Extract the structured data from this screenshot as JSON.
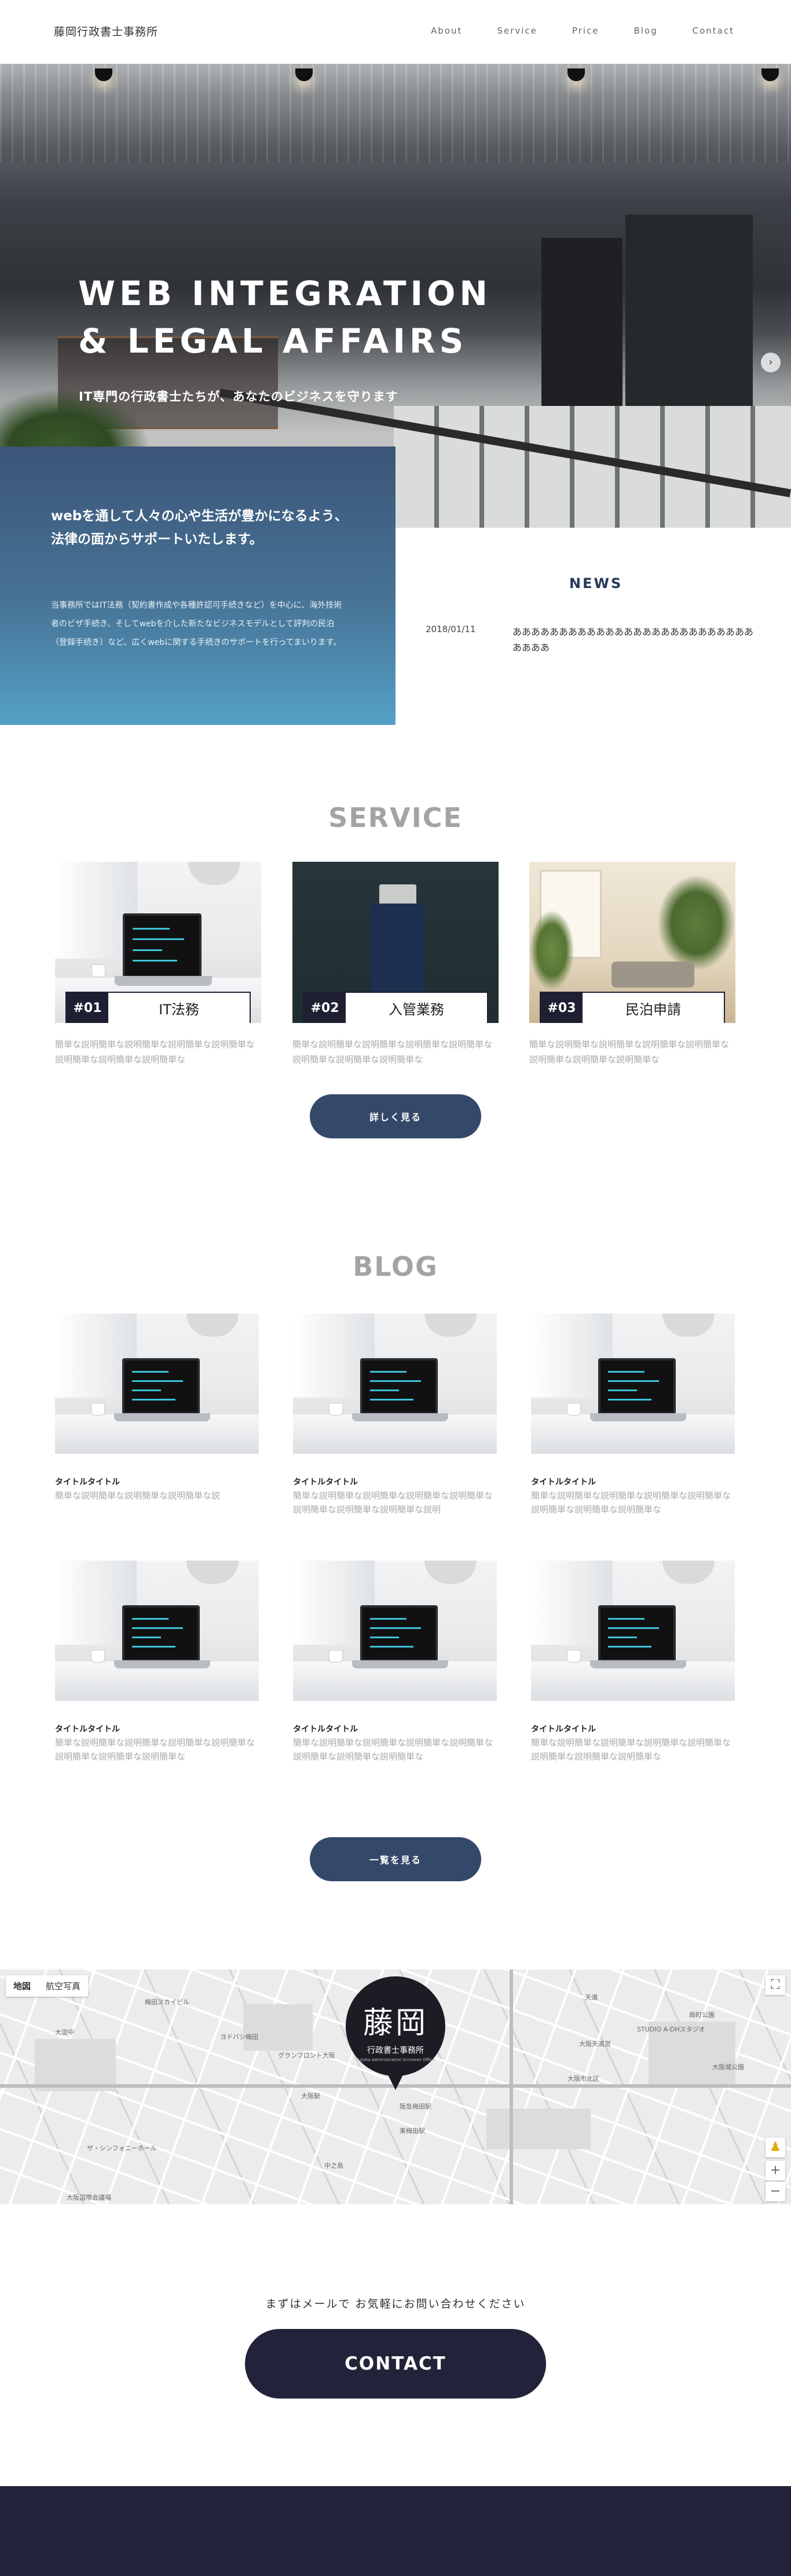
{
  "header": {
    "logo": "藤岡行政書士事務所",
    "nav": [
      "About",
      "Service",
      "Price",
      "Blog",
      "Contact"
    ]
  },
  "hero": {
    "title_line1": "WEB INTEGRATION",
    "title_line2": "& LEGAL AFFAIRS",
    "subtitle": "IT専門の行政書士たちが、あなたのビジネスを守ります",
    "next_arrow": "›"
  },
  "intro": {
    "heading": "webを通して人々の心や生活が豊かになるよう、法律の面からサポートいたします。",
    "body": "当事務所ではIT法務（契約書作成や各種許認可手続きなど）を中心に、海外技術者のビザ手続き、そしてwebを介した新たなビジネスモデルとして評判の民泊（登録手続き）など、広くwebに関する手続きのサポートを行ってまいります。"
  },
  "news": {
    "title": "NEWS",
    "items": [
      {
        "date": "2018/01/11",
        "text": "ああああああああああああああああああああああああああああああ"
      }
    ]
  },
  "service": {
    "title": "SERVICE",
    "cards": [
      {
        "num": "#01",
        "name": "IT法務",
        "desc": "簡単な説明簡単な説明簡単な説明簡単な説明簡単な説明簡単な説明簡単な説明簡単な"
      },
      {
        "num": "#02",
        "name": "入管業務",
        "desc": "簡単な説明簡単な説明簡単な説明簡単な説明簡単な説明簡単な説明簡単な説明簡単な"
      },
      {
        "num": "#03",
        "name": "民泊申請",
        "desc": "簡単な説明簡単な説明簡単な説明簡単な説明簡単な説明簡単な説明簡単な説明簡単な"
      }
    ],
    "more_button": "詳しく見る"
  },
  "blog": {
    "title": "BLOG",
    "posts": [
      {
        "title": "タイトルタイトル",
        "desc": "簡単な説明簡単な説明簡単な説明簡単な説"
      },
      {
        "title": "タイトルタイトル",
        "desc": "簡単な説明簡単な説明簡単な説明簡単な説明簡単な説明簡単な説明簡単な説明簡単な説明"
      },
      {
        "title": "タイトルタイトル",
        "desc": "簡単な説明簡単な説明簡単な説明簡単な説明簡単な説明簡単な説明簡単な説明簡単な"
      },
      {
        "title": "タイトルタイトル",
        "desc": "簡単な説明簡単な説明簡単な説明簡単な説明簡単な説明簡単な説明簡単な説明簡単な"
      },
      {
        "title": "タイトルタイトル",
        "desc": "簡単な説明簡単な説明簡単な説明簡単な説明簡単な説明簡単な説明簡単な説明簡単な"
      },
      {
        "title": "タイトルタイトル",
        "desc": "簡単な説明簡単な説明簡単な説明簡単な説明簡単な説明簡単な説明簡単な説明簡単な"
      }
    ],
    "more_button": "一覧を見る"
  },
  "map": {
    "tabs": [
      "地図",
      "航空写真"
    ],
    "marker_big": "藤岡",
    "marker_small": "行政書士事務所",
    "marker_tiny": "Fujioka Administrative Scrivener Office",
    "labels": [
      "梅田スカイビル",
      "大淀中",
      "ヨドバシ梅田",
      "グランフロント大阪",
      "大阪駅",
      "阪急梅田駅",
      "東梅田駅",
      "大阪城公園",
      "ザ・シンフォニーホール",
      "大阪国際会議場",
      "中之島",
      "天満",
      "扇町公園",
      "大阪天満宮",
      "STUDIO A-DHスタジオ",
      "大阪市北区"
    ],
    "zoom_in": "+",
    "zoom_out": "−",
    "fullscreen": "⛶",
    "pegman": "♟"
  },
  "contact": {
    "lead": "まずはメールで お気軽にお問い合わせください",
    "button": "CONTACT"
  },
  "colors": {
    "navy": "#22223a",
    "button_blue": "#34496a",
    "intro_top": "#3b5577",
    "intro_bottom": "#54a0c6",
    "heading_gray": "#a2a4a6"
  }
}
